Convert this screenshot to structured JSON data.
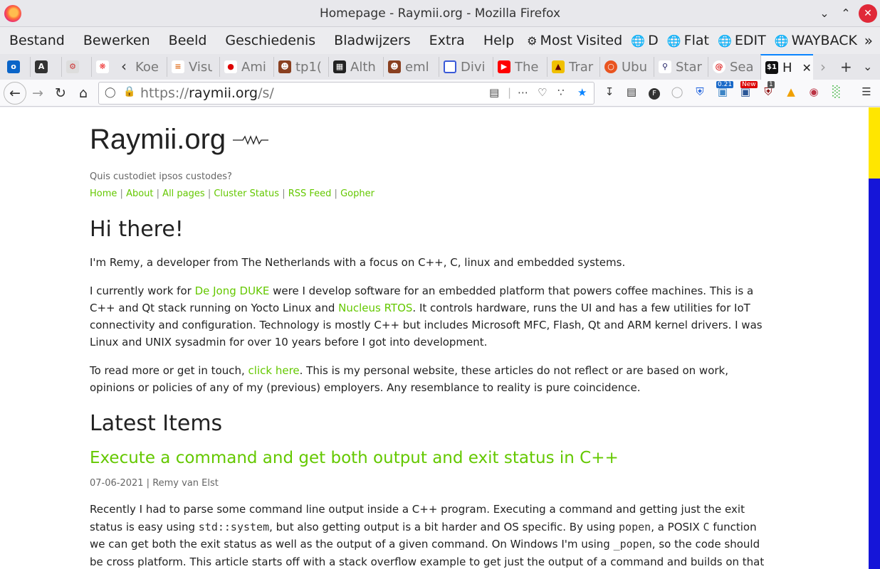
{
  "window": {
    "title": "Homepage - Raymii.org - Mozilla Firefox"
  },
  "menu": {
    "items": [
      "Bestand",
      "Bewerken",
      "Beeld",
      "Geschiedenis",
      "Bladwijzers",
      "Extra",
      "Help"
    ],
    "bookmarks": [
      {
        "label": "Most Visited",
        "icon": "gear-icon"
      },
      {
        "label": "D",
        "icon": "globe-icon"
      },
      {
        "label": "Flat",
        "icon": "globe-icon"
      },
      {
        "label": "EDIT",
        "icon": "globe-icon"
      },
      {
        "label": "WAYBACK",
        "icon": "globe-icon"
      }
    ],
    "overflow": "»"
  },
  "tabs": [
    {
      "label": "Koe"
    },
    {
      "label": "Visu"
    },
    {
      "label": "Ami"
    },
    {
      "label": "tp1("
    },
    {
      "label": "Alth"
    },
    {
      "label": "eml"
    },
    {
      "label": "Divi"
    },
    {
      "label": "The"
    },
    {
      "label": "Trar"
    },
    {
      "label": "Ubu"
    },
    {
      "label": "Star"
    },
    {
      "label": "Sea"
    },
    {
      "label": "H",
      "active": true
    }
  ],
  "navbar": {
    "url_scheme": "https://",
    "url_host": "raymii.org",
    "url_path": "/s/",
    "ext_badges": {
      "counter": "0.21",
      "new": "New",
      "ublock": "1"
    }
  },
  "site": {
    "title": "Raymii.org",
    "tagline": "Quis custodiet ipsos custodes?",
    "nav": [
      "Home",
      "About",
      "All pages",
      "Cluster Status",
      "RSS Feed",
      "Gopher"
    ],
    "nav_sep": "|"
  },
  "intro": {
    "heading": "Hi there!",
    "p1": "I'm Remy, a developer from The Netherlands with a focus on C++, C, linux and embedded systems.",
    "p2_a": "I currently work for ",
    "p2_link1": "De Jong DUKE",
    "p2_b": " were I develop software for an embedded platform that powers coffee machines. This is a C++ and Qt stack running on Yocto Linux and ",
    "p2_link2": "Nucleus RTOS",
    "p2_c": ". It controls hardware, runs the UI and has a few utilities for IoT connectivity and configuration. Technology is mostly C++ but includes Microsoft MFC, Flash, Qt and ARM kernel drivers. I was Linux and UNIX sysadmin for over 10 years before I got into development.",
    "p3_a": "To read more or get in touch, ",
    "p3_link": "click here",
    "p3_b": ". This is my personal website, these articles do not reflect or are based on work, opinions or policies of any of my (previous) employers. Any resemblance to reality is pure coincidence."
  },
  "latest": {
    "heading": "Latest Items",
    "article_title": "Execute a command and get both output and exit status in C++",
    "meta": "07-06-2021 | Remy van Elst",
    "s_a": "Recently I had to parse some command line output inside a C++ program. Executing a command and getting just the exit status is easy using ",
    "code1": "std::system",
    "s_b": ", but also getting output is a bit harder and OS specific. By using ",
    "code2": "popen",
    "s_c": ", a POSIX ",
    "code3": "C",
    "s_d": " function we can get both the exit status as well as the output of a given command. On Windows I'm using ",
    "code4": "_popen",
    "s_e": ", so the code should be cross platform. This article starts off with a stack overflow example to get just the output of a command and builds on that to a safer version (null-byte handling)"
  }
}
